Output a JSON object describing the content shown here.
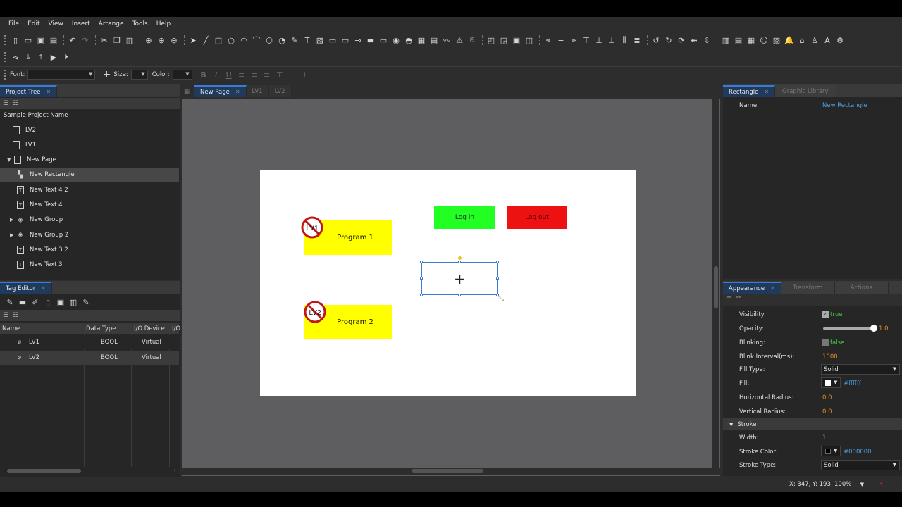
{
  "menu": [
    "File",
    "Edit",
    "View",
    "Insert",
    "Arrange",
    "Tools",
    "Help"
  ],
  "toolbar": {
    "row1_icons": [
      "new-doc",
      "open",
      "save",
      "save-as",
      "undo",
      "redo",
      "cut",
      "copy",
      "paste",
      "zoom-fit",
      "zoom-in",
      "zoom-out",
      "pointer",
      "line",
      "rectangle",
      "ellipse",
      "arc",
      "polyline",
      "polygon",
      "pie",
      "pen",
      "text",
      "image",
      "button",
      "input",
      "slider",
      "bar",
      "progress",
      "dial",
      "gauge",
      "chart",
      "table",
      "trend",
      "alarm",
      "camera",
      "bring-front",
      "send-back",
      "group",
      "ungroup",
      "align-left",
      "align-center",
      "align-right",
      "align-top",
      "align-middle",
      "align-bottom",
      "distribute-h",
      "distribute-v",
      "rotate-left",
      "rotate-right",
      "rotate",
      "flip-h",
      "flip-v",
      "db",
      "history",
      "recipe",
      "user",
      "script",
      "bell",
      "lock",
      "security",
      "translate",
      "more"
    ],
    "row2_icons": [
      "share",
      "download",
      "upload",
      "run",
      "run-sim"
    ]
  },
  "format_bar": {
    "font_label": "Font:",
    "size_label": "Size:",
    "color_label": "Color:",
    "font_value": "",
    "size_value": ""
  },
  "project_tree": {
    "tab": "Project Tree",
    "root": "Sample Project Name",
    "items": [
      {
        "label": "LV2",
        "icon": "page-icon",
        "indent": 0
      },
      {
        "label": "LV1",
        "icon": "page-icon",
        "indent": 0
      },
      {
        "label": "New Page",
        "icon": "page-icon",
        "indent": 0,
        "expanded": true
      },
      {
        "label": "New Rectangle",
        "icon": "rectangle-icon",
        "indent": 1,
        "selected": true
      },
      {
        "label": "New Text 4 2",
        "icon": "text-icon",
        "indent": 1
      },
      {
        "label": "New Text 4",
        "icon": "text-icon",
        "indent": 1
      },
      {
        "label": "New Group",
        "icon": "group-icon",
        "indent": 1,
        "collapsed": true
      },
      {
        "label": "New Group 2",
        "icon": "group-icon",
        "indent": 1,
        "collapsed": true
      },
      {
        "label": "New Text 3 2",
        "icon": "text-icon",
        "indent": 1
      },
      {
        "label": "New Text 3",
        "icon": "text-icon",
        "indent": 1
      }
    ]
  },
  "tag_editor": {
    "tab": "Tag Editor",
    "columns": [
      "Name",
      "Data Type",
      "I/O Device",
      "I/O"
    ],
    "rows": [
      {
        "name": "LV1",
        "type": "BOOL",
        "device": "Virtual"
      },
      {
        "name": "LV2",
        "type": "BOOL",
        "device": "Virtual"
      }
    ]
  },
  "editor_tabs": [
    "New Page",
    "LV1",
    "LV2"
  ],
  "canvas": {
    "program1": "Program 1",
    "program2": "Program 2",
    "badge1": "LV1",
    "badge2": "LV2",
    "login": "Log in",
    "logout": "Log out",
    "login_color": "#22ff22",
    "logout_color": "#ee1111",
    "program_color": "#ffff00"
  },
  "properties": {
    "tabs": [
      "Rectangle",
      "Graphic Library"
    ],
    "name_label": "Name:",
    "name_value": "New Rectangle"
  },
  "appearance": {
    "tabs": [
      "Appearance",
      "Transform",
      "Actions"
    ],
    "rows": [
      {
        "label": "Visibility:",
        "value": "true"
      },
      {
        "label": "Opacity:",
        "value": "1.0"
      },
      {
        "label": "Blinking:",
        "value": "false"
      },
      {
        "label": "Blink Interval(ms):",
        "value": "1000"
      },
      {
        "label": "Fill Type:",
        "value": "Solid"
      },
      {
        "label": "Fill:",
        "value": "#ffffff"
      },
      {
        "label": "Horizontal Radius:",
        "value": "0.0"
      },
      {
        "label": "Vertical Radius:",
        "value": "0.0"
      }
    ],
    "stroke_header": "Stroke",
    "stroke_rows": [
      {
        "label": "Width:",
        "value": "1"
      },
      {
        "label": "Stroke Color:",
        "value": "#000000"
      },
      {
        "label": "Stroke Type:",
        "value": "Solid"
      }
    ],
    "opacity_level": 1.0
  },
  "status": {
    "coords": "X: 347, Y: 193",
    "zoom": "100%"
  }
}
